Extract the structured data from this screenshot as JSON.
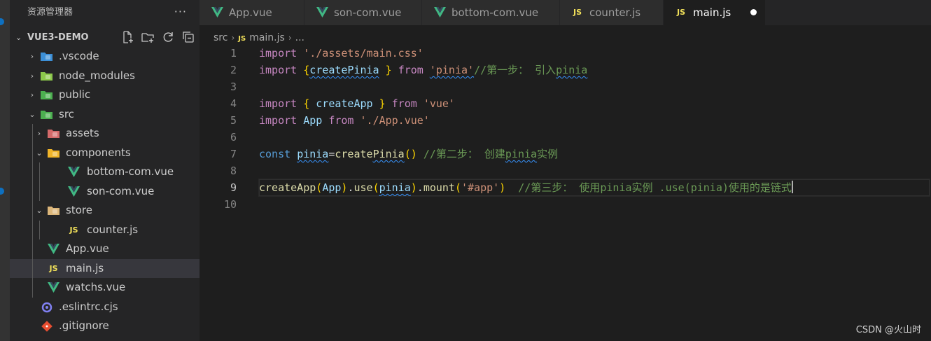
{
  "explorer": {
    "title": "资源管理器",
    "more_label": "···",
    "project": {
      "name": "VUE3-DEMO",
      "chevron": "⌄"
    },
    "actions": [
      {
        "name": "new-file-icon"
      },
      {
        "name": "new-folder-icon"
      },
      {
        "name": "refresh-icon"
      },
      {
        "name": "collapse-all-icon"
      }
    ],
    "tree": [
      {
        "label": ".vscode",
        "depth": 0,
        "chevron": "›",
        "icon": "vscode-folder-icon",
        "icon_color": "#3c8fd6"
      },
      {
        "label": "node_modules",
        "depth": 0,
        "chevron": "›",
        "icon": "node-folder-icon",
        "icon_color": "#8cc84b"
      },
      {
        "label": "public",
        "depth": 0,
        "chevron": "›",
        "icon": "public-folder-icon",
        "icon_color": "#4caf50"
      },
      {
        "label": "src",
        "depth": 0,
        "chevron": "⌄",
        "icon": "src-folder-icon",
        "icon_color": "#4caf50"
      },
      {
        "label": "assets",
        "depth": 1,
        "chevron": "›",
        "icon": "assets-folder-icon",
        "icon_color": "#d46a6a"
      },
      {
        "label": "components",
        "depth": 1,
        "chevron": "⌄",
        "icon": "components-folder-icon",
        "icon_color": "#f0b429"
      },
      {
        "label": "bottom-com.vue",
        "depth": 2,
        "chevron": "",
        "icon": "vue-file-icon",
        "icon_color": "#41b883"
      },
      {
        "label": "son-com.vue",
        "depth": 2,
        "chevron": "",
        "icon": "vue-file-icon",
        "icon_color": "#41b883"
      },
      {
        "label": "store",
        "depth": 1,
        "chevron": "⌄",
        "icon": "folder-open-icon",
        "icon_color": "#dcb67a"
      },
      {
        "label": "counter.js",
        "depth": 2,
        "chevron": "",
        "icon": "js-file-icon",
        "icon_color": "#f1e05a"
      },
      {
        "label": "App.vue",
        "depth": 1,
        "chevron": "",
        "icon": "vue-file-icon",
        "icon_color": "#41b883"
      },
      {
        "label": "main.js",
        "depth": 1,
        "chevron": "",
        "icon": "js-file-icon",
        "icon_color": "#f1e05a",
        "selected": true
      },
      {
        "label": "watchs.vue",
        "depth": 1,
        "chevron": "",
        "icon": "vue-file-icon",
        "icon_color": "#41b883"
      },
      {
        "label": ".eslintrc.cjs",
        "depth": 0,
        "chevron": "",
        "icon": "eslint-file-icon",
        "icon_color": "#8080f2"
      },
      {
        "label": ".gitignore",
        "depth": 0,
        "chevron": "",
        "icon": "git-file-icon",
        "icon_color": "#e84e31"
      }
    ]
  },
  "tabs": [
    {
      "label": "App.vue",
      "icon": "vue-file-icon"
    },
    {
      "label": "son-com.vue",
      "icon": "vue-file-icon"
    },
    {
      "label": "bottom-com.vue",
      "icon": "vue-file-icon"
    },
    {
      "label": "counter.js",
      "icon": "js-file-icon"
    },
    {
      "label": "main.js",
      "icon": "js-file-icon",
      "active": true,
      "dirty": true
    }
  ],
  "breadcrumb": {
    "folder": "src",
    "file": "main.js",
    "trail": "..."
  },
  "editor": {
    "line_numbers": [
      "1",
      "2",
      "3",
      "4",
      "5",
      "6",
      "7",
      "8",
      "9",
      "10"
    ],
    "active_line": 9,
    "lines": [
      [
        {
          "t": "import",
          "c": "kw"
        },
        {
          "t": " "
        },
        {
          "t": "'./assets/main.css'",
          "c": "str"
        }
      ],
      [
        {
          "t": "import",
          "c": "kw"
        },
        {
          "t": " "
        },
        {
          "t": "{",
          "c": "br1"
        },
        {
          "t": "createPinia",
          "c": "var",
          "sq": true
        },
        {
          "t": " "
        },
        {
          "t": "}",
          "c": "br1"
        },
        {
          "t": " "
        },
        {
          "t": "from",
          "c": "kw"
        },
        {
          "t": " "
        },
        {
          "t": "'pinia'",
          "c": "str",
          "sq": true
        },
        {
          "t": "//第一步： 引入",
          "c": "cmt"
        },
        {
          "t": "pinia",
          "c": "cmt",
          "sq": true
        }
      ],
      [],
      [
        {
          "t": "import",
          "c": "kw"
        },
        {
          "t": " "
        },
        {
          "t": "{",
          "c": "br1"
        },
        {
          "t": " "
        },
        {
          "t": "createApp",
          "c": "var"
        },
        {
          "t": " "
        },
        {
          "t": "}",
          "c": "br1"
        },
        {
          "t": " "
        },
        {
          "t": "from",
          "c": "kw"
        },
        {
          "t": " "
        },
        {
          "t": "'vue'",
          "c": "str"
        }
      ],
      [
        {
          "t": "import",
          "c": "kw"
        },
        {
          "t": " "
        },
        {
          "t": "App",
          "c": "var"
        },
        {
          "t": " "
        },
        {
          "t": "from",
          "c": "kw"
        },
        {
          "t": " "
        },
        {
          "t": "'./App.vue'",
          "c": "str"
        }
      ],
      [],
      [
        {
          "t": "const",
          "c": "kwb"
        },
        {
          "t": " "
        },
        {
          "t": "pinia",
          "c": "var",
          "sq": true
        },
        {
          "t": "="
        },
        {
          "t": "create",
          "c": "fn"
        },
        {
          "t": "Pinia",
          "c": "fn",
          "sq": true
        },
        {
          "t": "()",
          "c": "br1"
        },
        {
          "t": " "
        },
        {
          "t": "//第二步： 创建",
          "c": "cmt"
        },
        {
          "t": "pinia",
          "c": "cmt",
          "sq": true
        },
        {
          "t": "实例",
          "c": "cmt"
        }
      ],
      [],
      [
        {
          "t": "createApp",
          "c": "fn"
        },
        {
          "t": "(",
          "c": "br1"
        },
        {
          "t": "App",
          "c": "var"
        },
        {
          "t": ")",
          "c": "br1"
        },
        {
          "t": "."
        },
        {
          "t": "use",
          "c": "fn"
        },
        {
          "t": "(",
          "c": "br1"
        },
        {
          "t": "pinia",
          "c": "var",
          "sq": true
        },
        {
          "t": ")",
          "c": "br1"
        },
        {
          "t": "."
        },
        {
          "t": "mount",
          "c": "fn"
        },
        {
          "t": "(",
          "c": "br1"
        },
        {
          "t": "'#app'",
          "c": "str"
        },
        {
          "t": ")",
          "c": "br1"
        },
        {
          "t": "  "
        },
        {
          "t": "//第三步： 使用pinia实例 .use(pinia)使用的是链式",
          "c": "cmt"
        }
      ],
      []
    ]
  },
  "watermark": "CSDN @火山时"
}
